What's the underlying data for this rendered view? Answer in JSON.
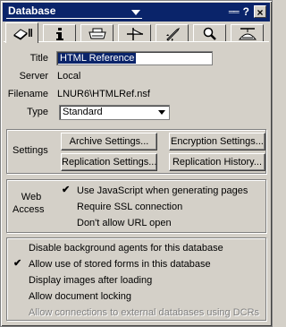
{
  "titlebar": {
    "title": "Database",
    "icons": [
      "pin-icon",
      "help-icon",
      "close-icon"
    ],
    "help_glyph": "?",
    "close_glyph": "×",
    "pin_glyph": "══"
  },
  "tabs": [
    {
      "name": "basics",
      "icon": "info-book-icon",
      "active": true
    },
    {
      "name": "info",
      "icon": "info-i-icon",
      "active": false
    },
    {
      "name": "printer",
      "icon": "printer-icon",
      "active": false
    },
    {
      "name": "design",
      "icon": "design-icon",
      "active": false
    },
    {
      "name": "launch",
      "icon": "rocket-icon",
      "active": false
    },
    {
      "name": "full-text",
      "icon": "magnifier-icon",
      "active": false
    },
    {
      "name": "advanced",
      "icon": "propeller-hat-icon",
      "active": false
    }
  ],
  "basics": {
    "title_label": "Title",
    "title_value": "HTML Reference",
    "server_label": "Server",
    "server_value": "Local",
    "filename_label": "Filename",
    "filename_value": "LNUR6\\HTMLRef.nsf",
    "type_label": "Type",
    "type_value": "Standard"
  },
  "settings": {
    "label": "Settings",
    "archive": "Archive Settings...",
    "encryption": "Encryption Settings...",
    "replication": "Replication Settings...",
    "history": "Replication History..."
  },
  "web_access": {
    "label_line1": "Web",
    "label_line2": "Access",
    "options": [
      {
        "label": "Use JavaScript when generating pages",
        "checked": true
      },
      {
        "label": "Require SSL connection",
        "checked": false
      },
      {
        "label": "Don't allow URL open",
        "checked": false
      }
    ]
  },
  "options": [
    {
      "label": "Disable background agents for this database",
      "checked": false,
      "disabled": false
    },
    {
      "label": "Allow use of stored forms in this database",
      "checked": true,
      "disabled": false
    },
    {
      "label": "Display images after loading",
      "checked": false,
      "disabled": false
    },
    {
      "label": "Allow document locking",
      "checked": false,
      "disabled": false
    },
    {
      "label": "Allow connections to external databases using DCRs",
      "checked": false,
      "disabled": true
    }
  ],
  "check_glyph": "✔",
  "colors": {
    "titlebar": "#0a246a",
    "face": "#d4d0c8",
    "selection": "#0a246a"
  }
}
